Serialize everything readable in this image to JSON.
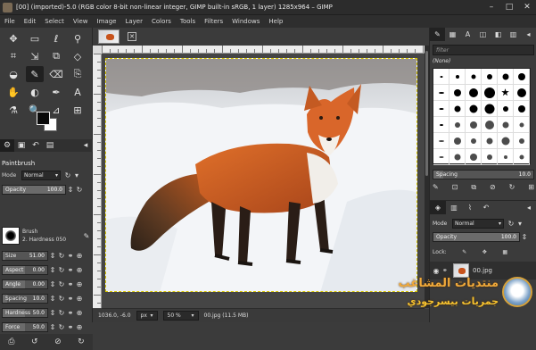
{
  "window": {
    "title": "[00] (imported)-5.0 (RGB color 8-bit non-linear integer, GIMP built-in sRGB, 1 layer) 1285x964 – GIMP",
    "minimize": "–",
    "maximize": "□",
    "close": "✕"
  },
  "menu": [
    "File",
    "Edit",
    "Select",
    "View",
    "Image",
    "Layer",
    "Colors",
    "Tools",
    "Filters",
    "Windows",
    "Help"
  ],
  "toolbox": {
    "tools": [
      {
        "name": "move-tool-icon",
        "glyph": "✥"
      },
      {
        "name": "rect-select-tool-icon",
        "glyph": "▭"
      },
      {
        "name": "lasso-tool-icon",
        "glyph": "ℓ"
      },
      {
        "name": "fuzzy-select-tool-icon",
        "glyph": "⚲"
      },
      {
        "name": "crop-tool-icon",
        "glyph": "⌗"
      },
      {
        "name": "unified-transform-tool-icon",
        "glyph": "⇲"
      },
      {
        "name": "warp-transform-tool-icon",
        "glyph": "⧉"
      },
      {
        "name": "cage-transform-tool-icon",
        "glyph": "◇"
      },
      {
        "name": "bucket-fill-tool-icon",
        "glyph": "◒"
      },
      {
        "name": "paintbrush-tool-icon",
        "glyph": "✎",
        "active": true
      },
      {
        "name": "eraser-tool-icon",
        "glyph": "⌫"
      },
      {
        "name": "clone-tool-icon",
        "glyph": "⎘"
      },
      {
        "name": "smudge-tool-icon",
        "glyph": "✋"
      },
      {
        "name": "dodge-burn-tool-icon",
        "glyph": "◐"
      },
      {
        "name": "paths-tool-icon",
        "glyph": "✒"
      },
      {
        "name": "text-tool-icon",
        "glyph": "A"
      },
      {
        "name": "color-picker-tool-icon",
        "glyph": "⚗"
      },
      {
        "name": "zoom-tool-icon",
        "glyph": "🔍"
      },
      {
        "name": "measure-tool-icon",
        "glyph": "⊿"
      },
      {
        "name": "align-tool-icon",
        "glyph": "⊞"
      }
    ],
    "swap_colors": "⇄",
    "fg_color": "#0a0a0a",
    "bg_color": "#ffffff"
  },
  "tool_options": {
    "title": "Paintbrush",
    "mode_label": "Mode",
    "mode_value": "Normal",
    "opacity_label": "Opacity",
    "opacity_value": "100.0",
    "brush_label": "Brush",
    "brush_name": "2. Hardness 050",
    "size_label": "Size",
    "size_value": "51.00",
    "aspect_label": "Aspect",
    "aspect_value": "0.00",
    "angle_label": "Angle",
    "angle_value": "0.00",
    "spacing_label": "Spacing",
    "spacing_value": "10.0",
    "hardness_label": "Hardness",
    "hardness_value": "50.0",
    "force_label": "Force",
    "force_value": "50.0"
  },
  "status": {
    "coords": "1036.0, -6.0",
    "unit": "px",
    "zoom": "50 %",
    "info": "00.jpg (11.5 MB)"
  },
  "brushes_panel": {
    "filter_placeholder": "filter",
    "none_label": "(None)",
    "spacing_label": "Spacing",
    "spacing_value": "10.0"
  },
  "layers_panel": {
    "mode_label": "Mode",
    "mode_value": "Normal",
    "opacity_label": "Opacity",
    "opacity_value": "100.0",
    "lock_label": "Lock:",
    "layer_name": "00.jpg"
  },
  "watermark": {
    "line1": "منتديات المشاغب",
    "line2": "جمريات بيسرجودي"
  }
}
